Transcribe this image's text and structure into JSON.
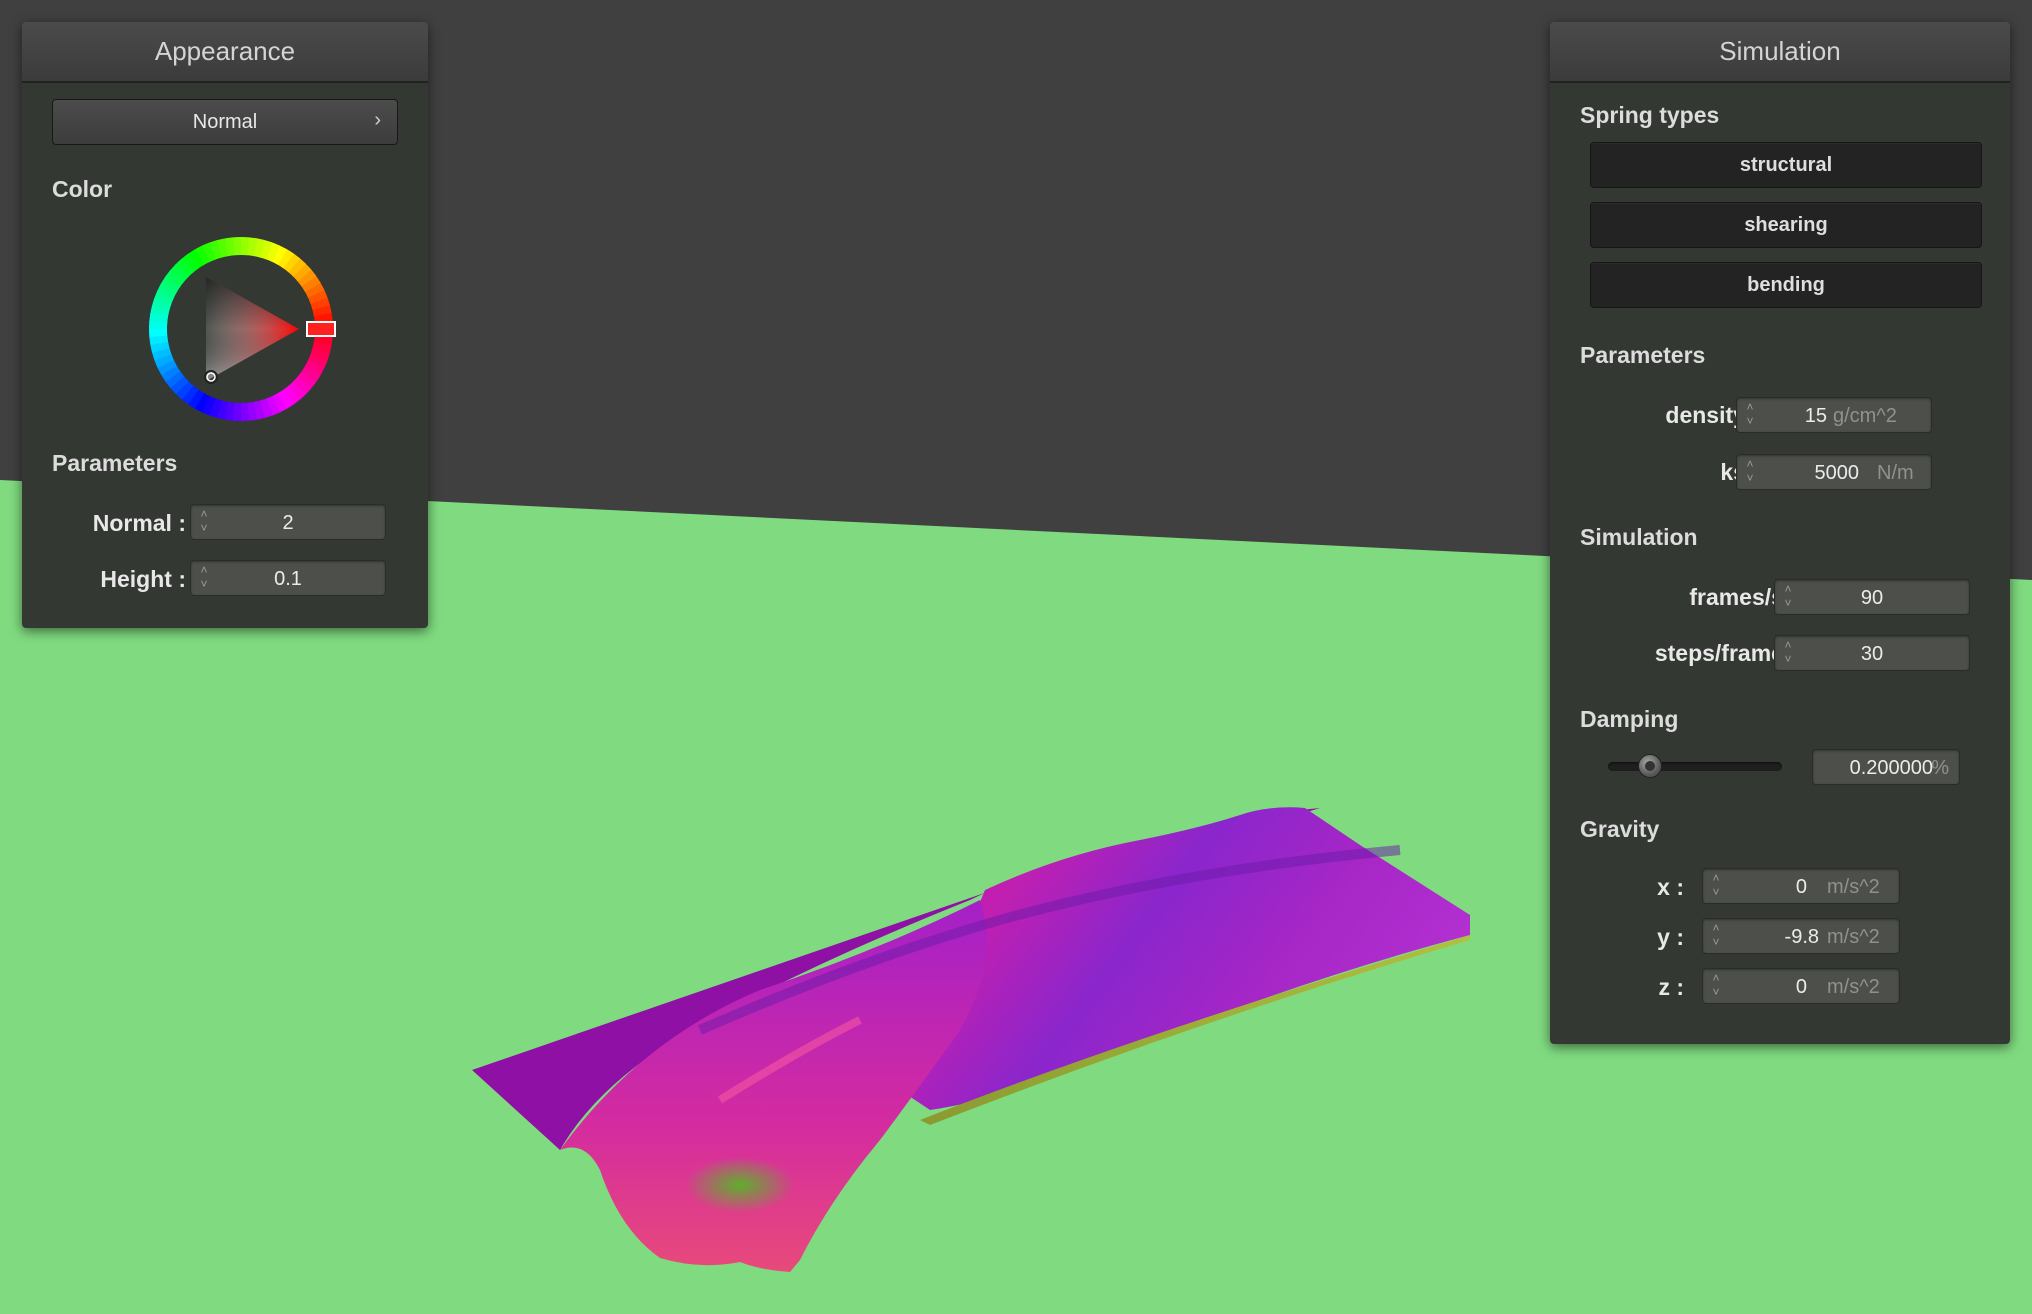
{
  "appearance": {
    "title": "Appearance",
    "mode_label": "Normal",
    "color_section": "Color",
    "parameters_section": "Parameters",
    "normal_label": "Normal :",
    "normal_value": "2",
    "height_label": "Height :",
    "height_value": "0.1",
    "selected_color": "#ff0000"
  },
  "simulation": {
    "title": "Simulation",
    "spring_types_section": "Spring types",
    "spring_types": [
      "structural",
      "shearing",
      "bending"
    ],
    "parameters_section": "Parameters",
    "density_label": "density :",
    "density_value": "15",
    "density_unit": "g/cm^2",
    "ks_label": "ks :",
    "ks_value": "5000",
    "ks_unit": "N/m",
    "simulation_section": "Simulation",
    "fps_label": "frames/s :",
    "fps_value": "90",
    "steps_label": "steps/frame :",
    "steps_value": "30",
    "damping_section": "Damping",
    "damping_value": "0.200000",
    "damping_unit": "%",
    "damping_fraction": 0.2,
    "gravity_section": "Gravity",
    "gx_label": "x :",
    "gx_value": "0",
    "gy_label": "y :",
    "gy_value": "-9.8",
    "gz_label": "z :",
    "gz_value": "0",
    "gravity_unit": "m/s^2"
  },
  "scene": {
    "background_color": "#404040",
    "floor_color": "#80db80",
    "cloth_color": "#a020d8"
  }
}
